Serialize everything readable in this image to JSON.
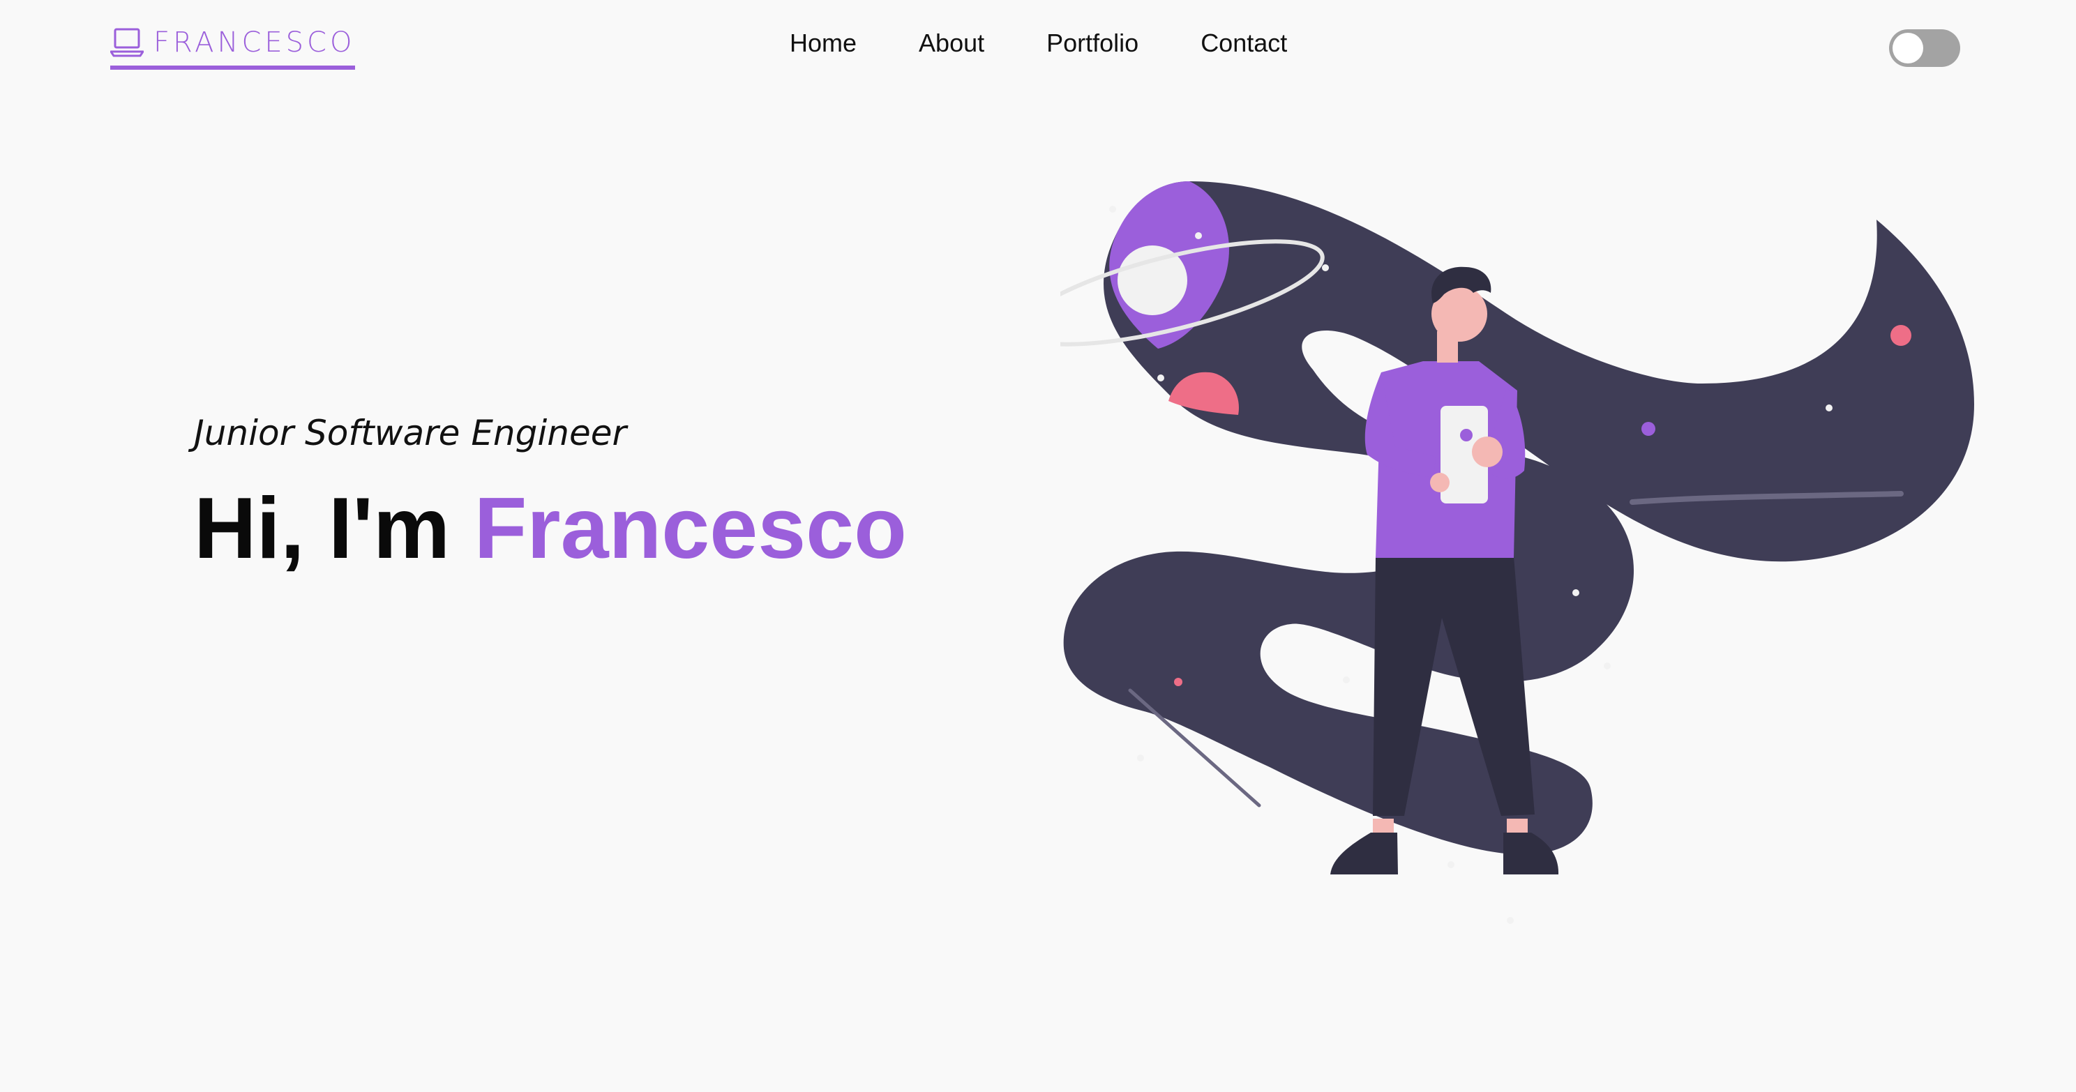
{
  "brand": {
    "name": "FRANCESCO",
    "icon": "laptop-icon",
    "color": "#9b5fdb"
  },
  "nav": {
    "items": [
      {
        "label": "Home"
      },
      {
        "label": "About"
      },
      {
        "label": "Portfolio"
      },
      {
        "label": "Contact"
      }
    ]
  },
  "theme_toggle": {
    "state": "off"
  },
  "hero": {
    "subtitle": "Junior Software Engineer",
    "greeting": "Hi, I'm",
    "name": "Francesco",
    "illustration": "person-with-phone-space-illustration"
  },
  "colors": {
    "accent": "#9b5fdb",
    "background": "#f9f9f9",
    "text": "#0a0a0a",
    "space": "#3f3d56",
    "planet_pink": "#ee6e87"
  }
}
